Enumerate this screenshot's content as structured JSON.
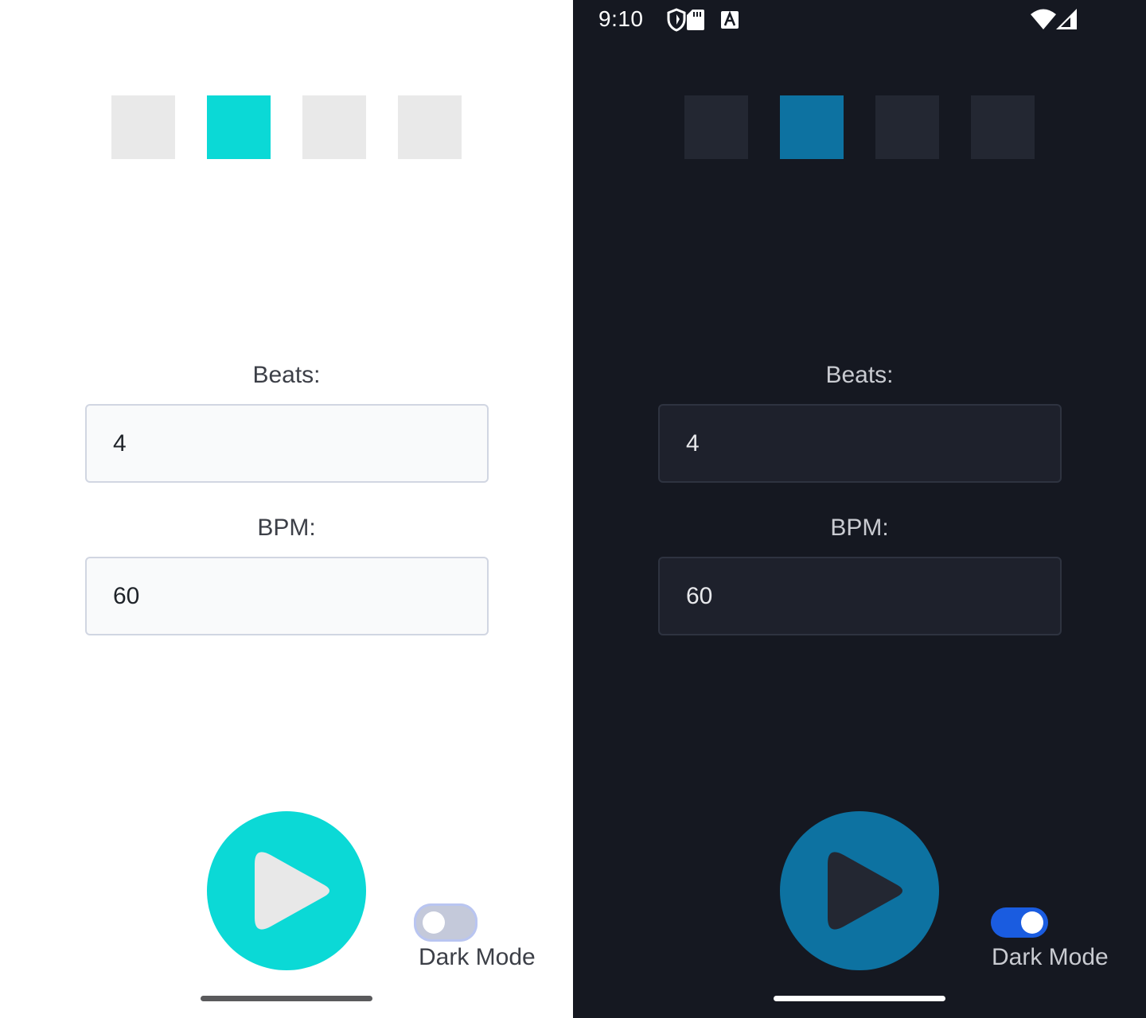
{
  "status_bar": {
    "time": "9:10",
    "icons": [
      "shield-icon",
      "sd-card-icon",
      "accessibility-a-icon",
      "wifi-icon",
      "cellular-signal-icon"
    ]
  },
  "beat_indicators": {
    "count": 4,
    "active_index": 1
  },
  "beats": {
    "label": "Beats:",
    "value": "4"
  },
  "bpm": {
    "label": "BPM:",
    "value": "60"
  },
  "play_button": {
    "icon": "play-icon"
  },
  "dark_mode_toggle": {
    "label": "Dark Mode"
  },
  "light_theme": {
    "background": "#ffffff",
    "accent": "#0bd9d6",
    "inactive_box": "#e9e9e9",
    "text": "#3c3f47",
    "dark_mode_on": false
  },
  "dark_theme": {
    "background": "#151821",
    "accent": "#0d72a1",
    "inactive_box": "#232732",
    "text": "#c9cbd1",
    "toggle_on_color": "#1a5ce0",
    "dark_mode_on": true
  }
}
